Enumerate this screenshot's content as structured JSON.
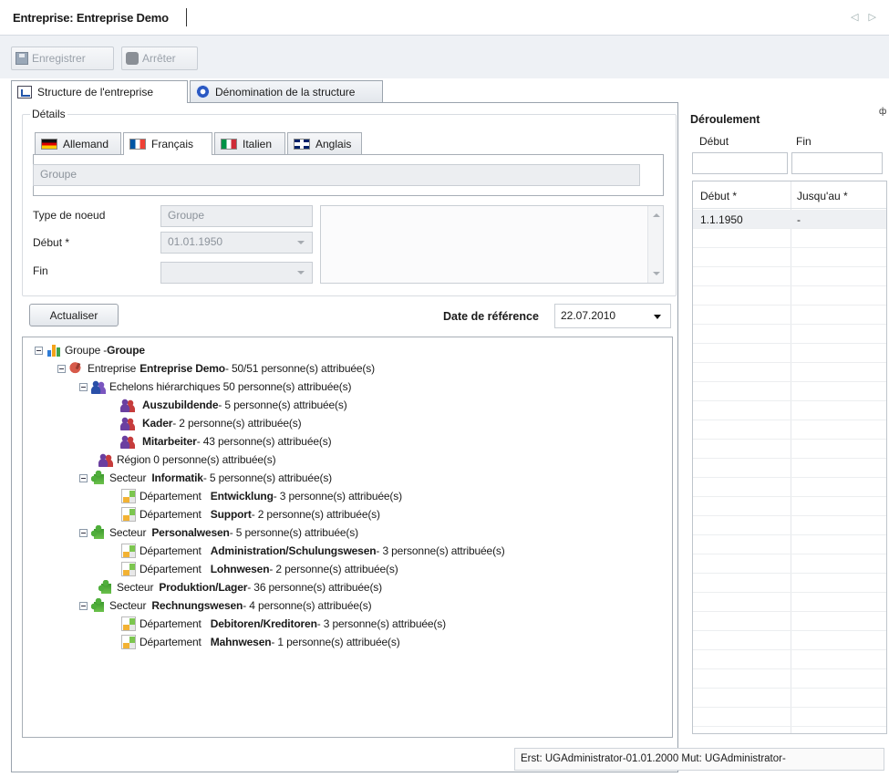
{
  "window": {
    "title": "Entreprise: Entreprise Demo",
    "nav": "◁ ▷"
  },
  "toolbar": {
    "save_label": "Enregistrer",
    "stop_label": "Arrêter"
  },
  "tabs": [
    {
      "label": "Structure de l'entreprise"
    },
    {
      "label": "Dénomination de la structure"
    }
  ],
  "details": {
    "title": "Détails",
    "language_tabs": [
      {
        "label": "Allemand"
      },
      {
        "label": "Français"
      },
      {
        "label": "Italien"
      },
      {
        "label": "Anglais"
      }
    ],
    "name_value": "Groupe",
    "node_type_label": "Type de noeud",
    "node_type_value": "Groupe",
    "start_label": "Début *",
    "start_value": "01.01.1950",
    "end_label": "Fin",
    "end_value": ""
  },
  "refresh_label": "Actualiser",
  "ref_date": {
    "label": "Date de référence",
    "value": "22.07.2010"
  },
  "tree": [
    {
      "prefix": "Groupe - ",
      "name": "Groupe",
      "suffix": ""
    },
    {
      "prefix": "Entreprise ",
      "name": "Entreprise Demo",
      "suffix": " - 50/51 personne(s) attribuée(s)"
    },
    {
      "prefix": "Echelons hiérarchiques  50 personne(s) attribuée(s)",
      "name": "",
      "suffix": ""
    },
    {
      "prefix": "",
      "name": "Auszubildende",
      "suffix": " - 5 personne(s) attribuée(s)"
    },
    {
      "prefix": "",
      "name": "Kader",
      "suffix": " - 2 personne(s) attribuée(s)"
    },
    {
      "prefix": "",
      "name": "Mitarbeiter",
      "suffix": " - 43 personne(s) attribuée(s)"
    },
    {
      "prefix": "Région  0 personne(s) attribuée(s)",
      "name": "",
      "suffix": ""
    },
    {
      "prefix": "Secteur ",
      "name": "Informatik",
      "suffix": " - 5 personne(s) attribuée(s)"
    },
    {
      "prefix": "Département ",
      "name": "Entwicklung",
      "suffix": " - 3 personne(s) attribuée(s)"
    },
    {
      "prefix": "Département ",
      "name": "Support",
      "suffix": " - 2 personne(s) attribuée(s)"
    },
    {
      "prefix": "Secteur ",
      "name": "Personalwesen",
      "suffix": " - 5 personne(s) attribuée(s)"
    },
    {
      "prefix": "Département ",
      "name": "Administration/Schulungswesen",
      "suffix": " - 3 personne(s) attribuée(s)"
    },
    {
      "prefix": "Département ",
      "name": "Lohnwesen",
      "suffix": " - 2 personne(s) attribuée(s)"
    },
    {
      "prefix": "Secteur ",
      "name": "Produktion/Lager",
      "suffix": " - 36 personne(s) attribuée(s)"
    },
    {
      "prefix": "Secteur ",
      "name": "Rechnungswesen",
      "suffix": " - 4 personne(s) attribuée(s)"
    },
    {
      "prefix": "Département ",
      "name": "Debitoren/Kreditoren",
      "suffix": " - 3 personne(s) attribuée(s)"
    },
    {
      "prefix": "Département ",
      "name": "Mahnwesen",
      "suffix": " - 1 personne(s) attribuée(s)"
    }
  ],
  "timeline": {
    "title": "Déroulement",
    "filter_start_label": "Début",
    "filter_end_label": "Fin",
    "columns": [
      "Début *",
      "Jusqu'au *"
    ],
    "rows": [
      [
        "1.1.1950",
        "-"
      ]
    ]
  },
  "audit": "Erst: UGAdministrator-01.01.2000  Mut: UGAdministrator-"
}
